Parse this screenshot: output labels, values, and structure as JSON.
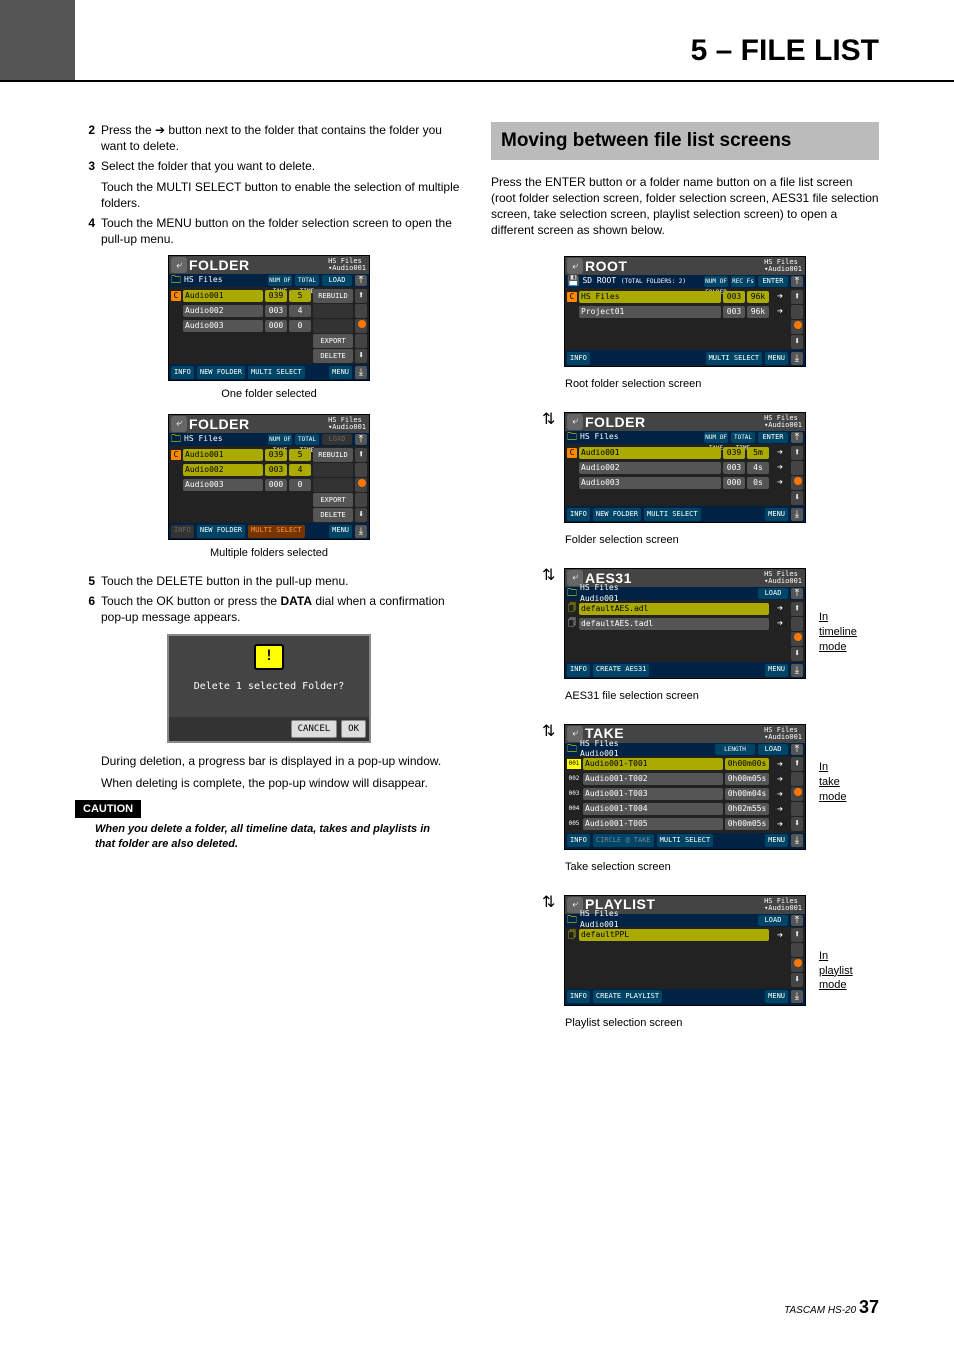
{
  "header": {
    "title": "5 – FILE LIST"
  },
  "left": {
    "items": [
      {
        "n": "2",
        "t": "Press the ➔ button next to the folder that contains the folder you want to delete."
      },
      {
        "n": "3",
        "t": "Select the folder that you want to delete."
      },
      {
        "n": "",
        "t": "Touch the MULTI SELECT button to enable the selection of multiple folders."
      },
      {
        "n": "4",
        "t": "Touch the MENU button on the folder selection screen to open the pull-up menu."
      }
    ],
    "caption1": "One folder selected",
    "caption2": "Multiple folders selected",
    "items2": [
      {
        "n": "5",
        "t": "Touch the DELETE button in the pull-up menu."
      },
      {
        "n": "6",
        "t": "Touch the OK button or press the DATA dial when a confirmation pop-up message appears."
      }
    ],
    "popup": {
      "msg": "Delete 1 selected Folder?",
      "cancel": "CANCEL",
      "ok": "OK"
    },
    "para1": "During deletion, a progress bar is displayed in a pop-up window.",
    "para2": "When deleting is complete, the pop-up window will disappear.",
    "caution_label": "CAUTION",
    "caution_text": "When you delete a folder, all timeline data, takes and playlists in that folder are also deleted.",
    "folder_screen": {
      "title": "FOLDER",
      "hs1": "HS Files",
      "hs2": "Audio001",
      "bread": "HS Files",
      "hd1": "NUM OF TAKE",
      "hd2": "TOTAL TIME",
      "btn_load": "LOAD",
      "btn_rebuild": "REBUILD",
      "btn_export": "EXPORT",
      "btn_delete": "DELETE",
      "r1_name": "Audio001",
      "r1_a": "039",
      "r1_b": "5",
      "r2_name": "Audio002",
      "r2_a": "003",
      "r2_b": "4",
      "r3_name": "Audio003",
      "r3_a": "000",
      "r3_b": "0",
      "btm_info": "INFO",
      "btm_new": "NEW FOLDER",
      "btm_multi": "MULTI SELECT",
      "btm_menu": "MENU"
    }
  },
  "right": {
    "section": "Moving between file list screens",
    "intro": "Press the ENTER button or a folder name button on a file list screen (root folder selection screen, folder selection screen, AES31 file selection screen, take selection screen, playlist selection screen) to open a different screen as shown below.",
    "cap_root": "Root folder selection screen",
    "cap_folder": "Folder selection screen",
    "cap_aes": "AES31 file selection screen",
    "cap_take": "Take selection screen",
    "cap_playlist": "Playlist selection screen",
    "mode_timeline": "In timeline mode",
    "mode_take": "In take mode",
    "mode_playlist": "In playlist mode",
    "root": {
      "title": "ROOT",
      "hs1": "HS Files",
      "hs2": "Audio001",
      "crumb": "SD ROOT",
      "crumb2": "(TOTAL FOLDERS: 2)",
      "hd1": "NUM OF FOLDER",
      "hd2": "REC Fs",
      "enter": "ENTER",
      "r1_name": "HS Files",
      "r1_a": "003",
      "r1_b": "96k",
      "r2_name": "Project01",
      "r2_a": "003",
      "r2_b": "96k",
      "btm_info": "INFO",
      "btm_multi": "MULTI SELECT",
      "btm_menu": "MENU"
    },
    "folder": {
      "title": "FOLDER",
      "hs1": "HS Files",
      "hs2": "Audio001",
      "bread": "HS Files",
      "hd1": "NUM OF TAKE",
      "hd2": "TOTAL TIME",
      "enter": "ENTER",
      "r1_name": "Audio001",
      "r1_a": "039",
      "r1_b": "5m",
      "r2_name": "Audio002",
      "r2_a": "003",
      "r2_b": "4s",
      "r3_name": "Audio003",
      "r3_a": "000",
      "r3_b": "0s",
      "btm_info": "INFO",
      "btm_new": "NEW FOLDER",
      "btm_multi": "MULTI SELECT",
      "btm_menu": "MENU"
    },
    "aes": {
      "title": "AES31",
      "hs1": "HS Files",
      "hs2": "Audio001",
      "crumb": "HS Files",
      "crumb2": "Audio001",
      "btn_load": "LOAD",
      "r1": "defaultAES.adl",
      "r2": "defaultAES.tadl",
      "btm_info": "INFO",
      "btm_create": "CREATE AES31",
      "btm_menu": "MENU"
    },
    "take": {
      "title": "TAKE",
      "hs1": "HS Files",
      "hs2": "Audio001",
      "crumb": "HS Files",
      "crumb2": "Audio001",
      "hd1": "LENGTH",
      "btn_load": "LOAD",
      "rows": [
        {
          "i": "001",
          "n": "Audio001-T001",
          "l": "0h00m00s"
        },
        {
          "i": "002",
          "n": "Audio001-T002",
          "l": "0h00m05s"
        },
        {
          "i": "003",
          "n": "Audio001-T003",
          "l": "0h00m04s"
        },
        {
          "i": "004",
          "n": "Audio001-T004",
          "l": "0h02m55s"
        },
        {
          "i": "005",
          "n": "Audio001-T005",
          "l": "0h00m05s"
        }
      ],
      "btm_info": "INFO",
      "btm_circle": "CIRCLE @ TAKE",
      "btm_multi": "MULTI SELECT",
      "btm_menu": "MENU"
    },
    "playlist": {
      "title": "PLAYLIST",
      "hs1": "HS Files",
      "hs2": "Audio001",
      "crumb": "HS Files",
      "crumb2": "Audio001",
      "btn_load": "LOAD",
      "r1": "defaultPPL",
      "btm_info": "INFO",
      "btm_create": "CREATE PLAYLIST",
      "btm_menu": "MENU"
    }
  },
  "footer": {
    "brand": "TASCAM HS-20",
    "page": "37"
  }
}
